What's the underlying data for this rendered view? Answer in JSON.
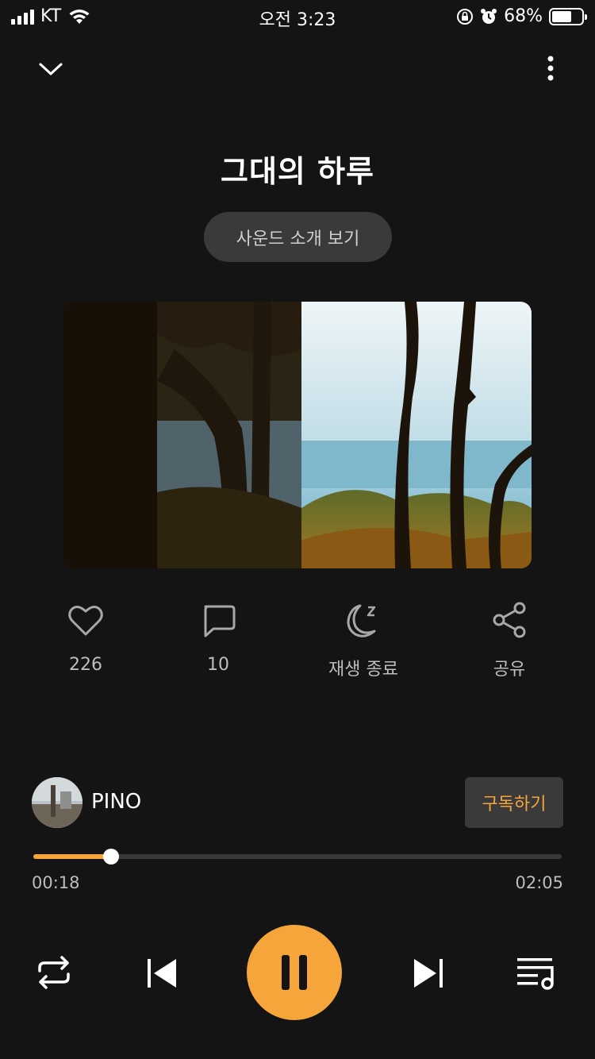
{
  "status_bar": {
    "carrier": "KT",
    "time": "오전 3:23",
    "battery_percent": "68%",
    "battery_level": 0.68
  },
  "player": {
    "title": "그대의 하루",
    "intro_button": "사운드 소개 보기"
  },
  "actions": {
    "like_count": "226",
    "comment_count": "10",
    "sleep_timer_label": "재생 종료",
    "share_label": "공유"
  },
  "creator": {
    "name": "PINO",
    "subscribe_label": "구독하기"
  },
  "progress": {
    "current": "00:18",
    "total": "02:05",
    "fraction": 0.147
  },
  "icons": {
    "collapse": "chevron-down-icon",
    "more": "more-vertical-icon",
    "like": "heart-icon",
    "comment": "comment-icon",
    "sleep": "moon-sleep-icon",
    "share": "share-icon",
    "repeat": "repeat-icon",
    "prev": "skip-previous-icon",
    "pause": "pause-icon",
    "next": "skip-next-icon",
    "playlist": "playlist-icon"
  },
  "colors": {
    "background": "#141414",
    "accent": "#f5a53a",
    "surface": "#3a3a3a"
  }
}
